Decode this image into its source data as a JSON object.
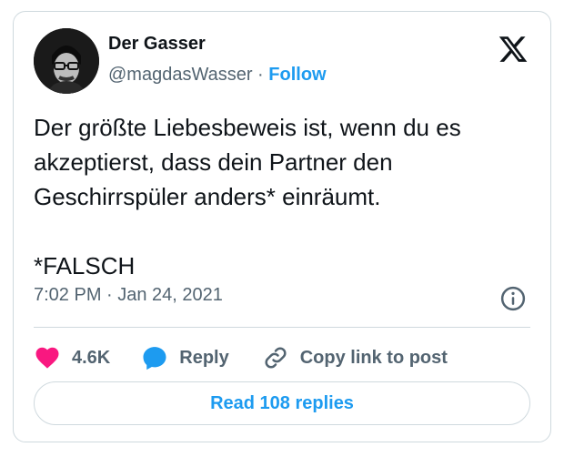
{
  "author": {
    "name": "Der Gasser",
    "handle": "@magdasWasser",
    "separator": " · ",
    "follow_label": "Follow"
  },
  "tweet": {
    "lines": [
      "Der größte Liebesbeweis ist, wenn du es",
      "akzeptierst, dass dein Partner den",
      "Geschirrspüler anders* einräumt."
    ],
    "footnote": "*FALSCH",
    "timestamp": "7:02 PM · Jan 24, 2021"
  },
  "actions": {
    "like_count": "4.6K",
    "reply_label": "Reply",
    "copy_link_label": "Copy link to post"
  },
  "read_replies_label": "Read 108 replies",
  "icons": [
    "x-logo-icon",
    "info-icon",
    "heart-icon",
    "reply-bubble-icon",
    "link-icon"
  ],
  "colors": {
    "accent": "#1d9bf0",
    "heart": "#f91880",
    "secondary_text": "#536471",
    "border": "#cfd9de"
  }
}
